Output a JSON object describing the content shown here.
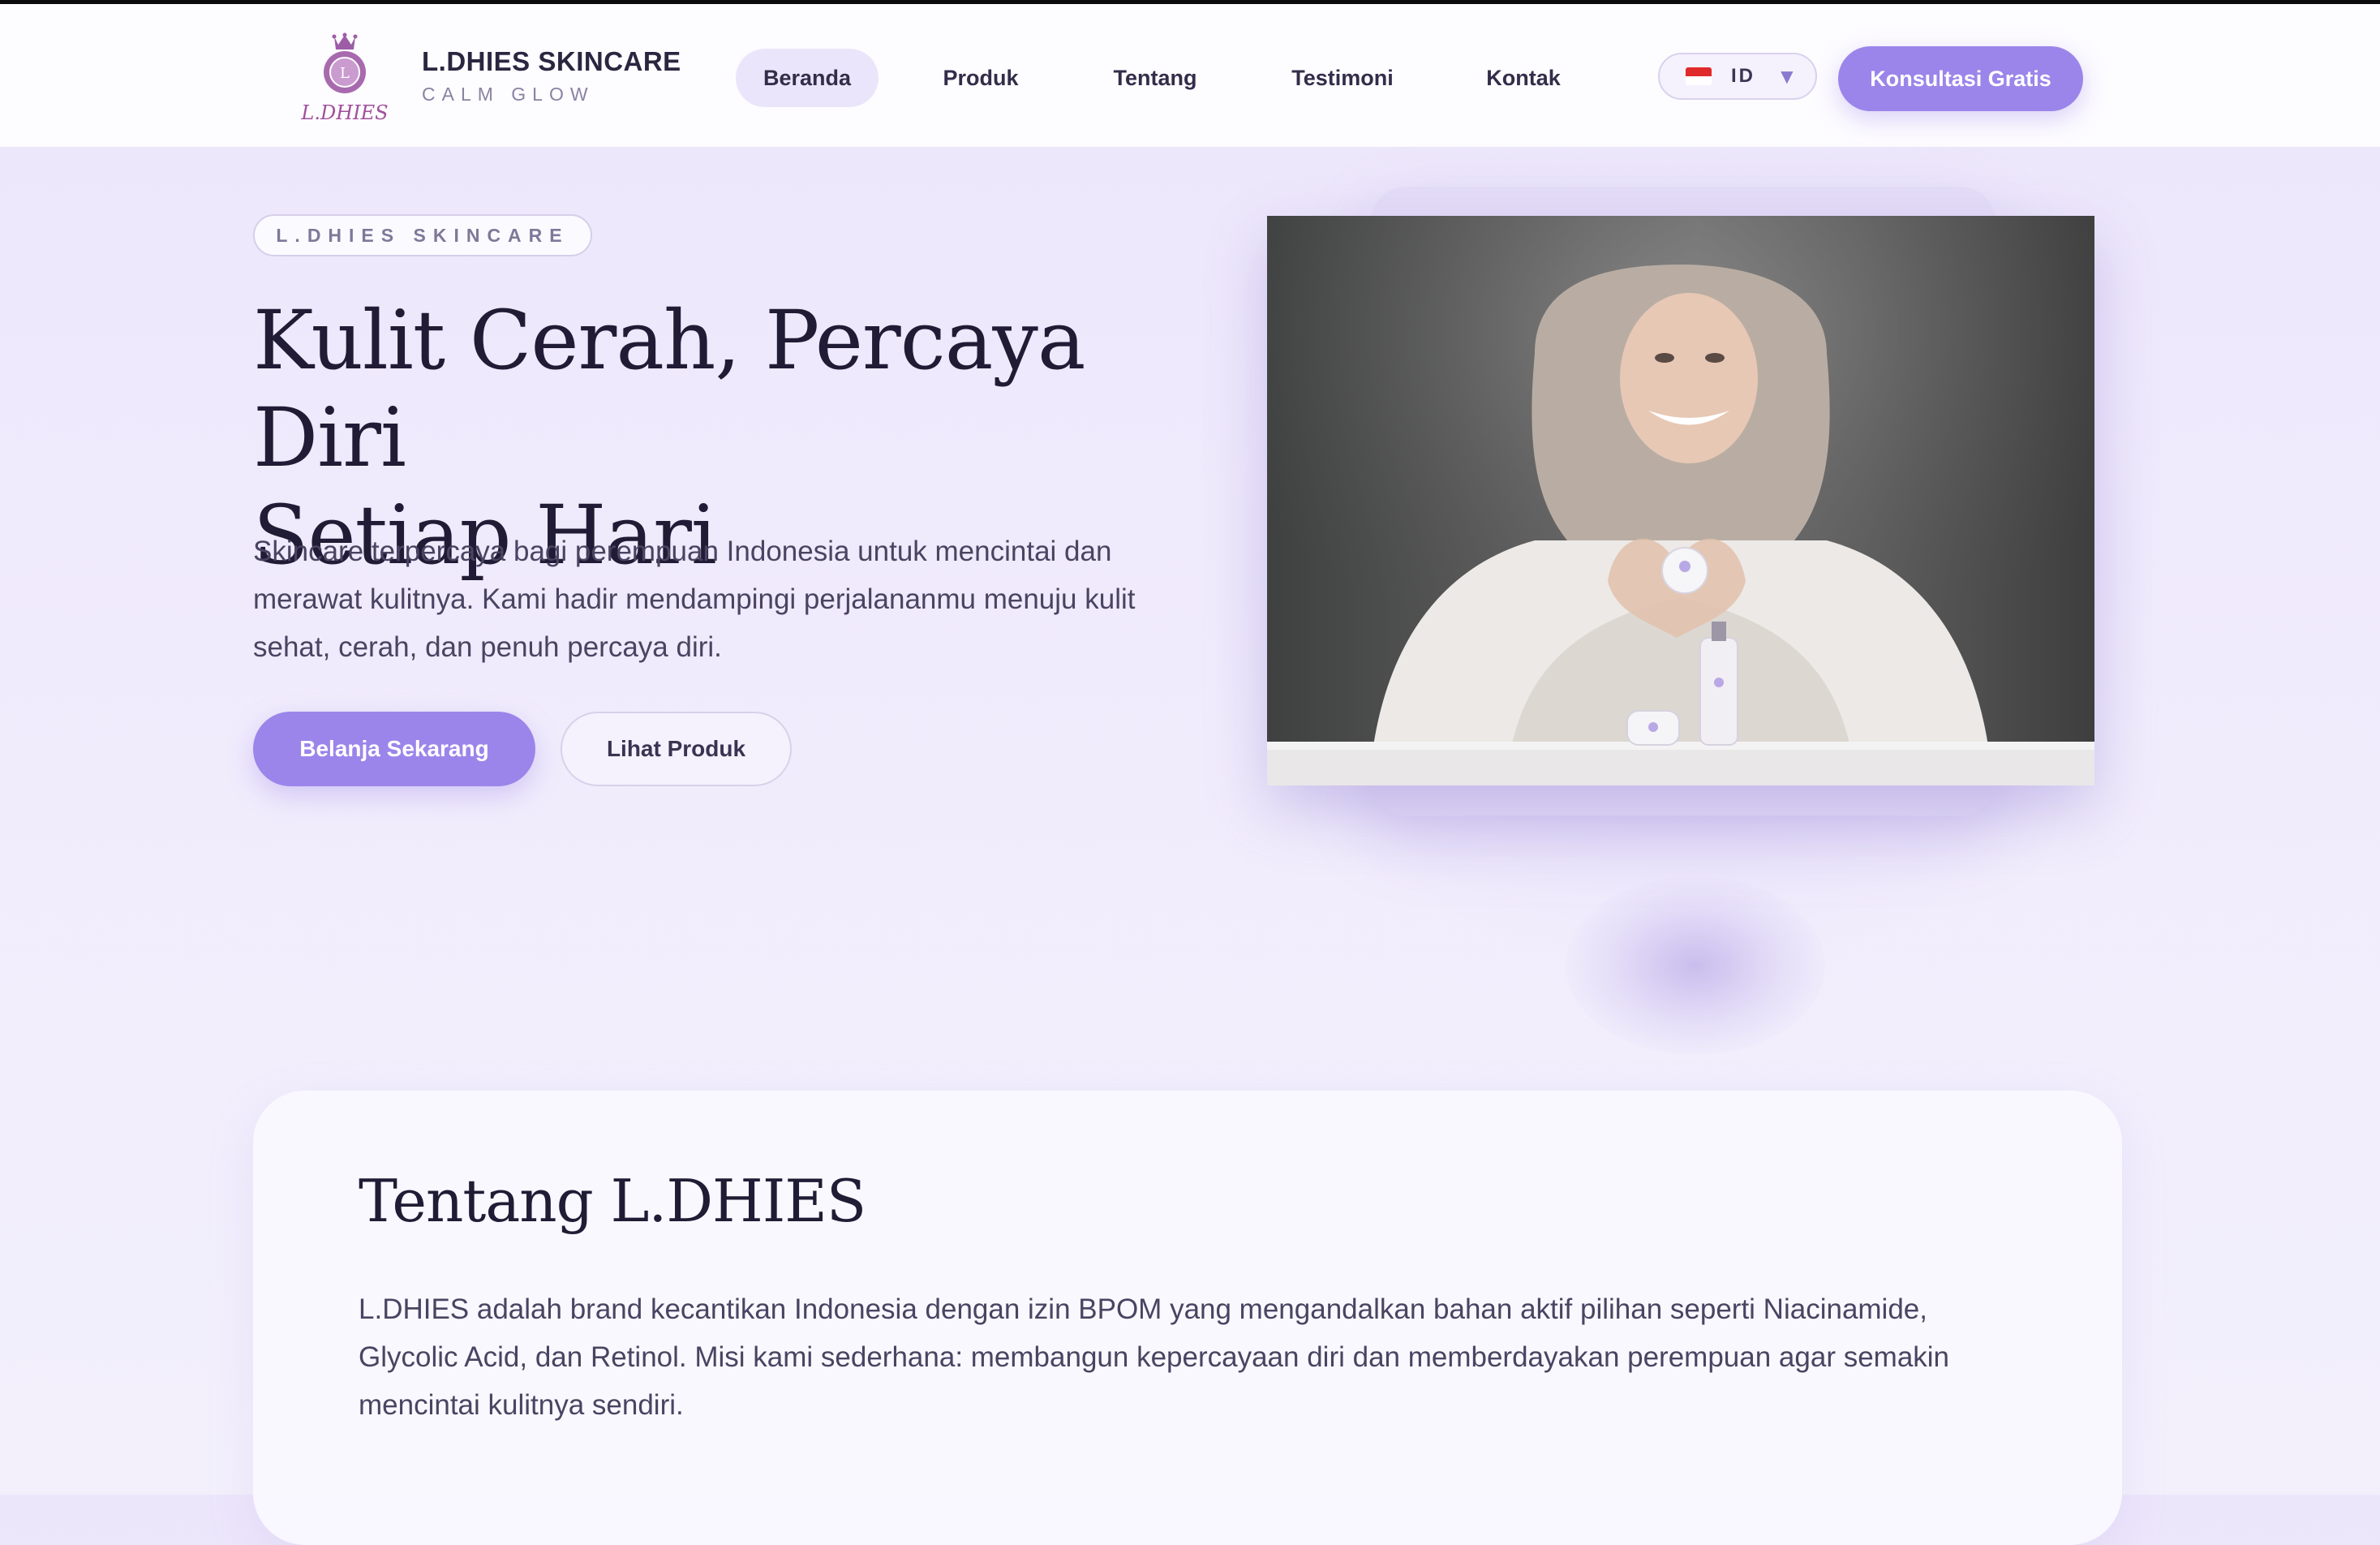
{
  "header": {
    "logo_text": "L.DHIES",
    "brand_name": "L.DHIES SKINCARE",
    "brand_tagline": "CALM GLOW",
    "nav": [
      {
        "label": "Beranda",
        "active": true
      },
      {
        "label": "Produk",
        "active": false
      },
      {
        "label": "Tentang",
        "active": false
      },
      {
        "label": "Testimoni",
        "active": false
      },
      {
        "label": "Kontak",
        "active": false
      }
    ],
    "language": {
      "code": "ID",
      "flag": "indonesia-flag-icon"
    },
    "cta_label": "Konsultasi Gratis"
  },
  "hero": {
    "badge": "L.DHIES SKINCARE",
    "title_line1": "Kulit Cerah, Percaya Diri",
    "title_line2": "Setiap Hari",
    "description": "Skincare terpercaya bagi perempuan Indonesia untuk mencintai dan merawat kulitnya. Kami hadir mendampingi perjalananmu menuju kulit sehat, cerah, dan penuh percaya diri.",
    "primary_button": "Belanja Sekarang",
    "secondary_button": "Lihat Produk"
  },
  "about": {
    "title": "Tentang L.DHIES",
    "text": "L.DHIES adalah brand kecantikan Indonesia dengan izin BPOM yang mengandalkan bahan aktif pilihan seperti Niacinamide, Glycolic Acid, dan Retinol. Misi kami sederhana: membangun kepercayaan diri dan memberdayakan perempuan agar semakin mencintai kulitnya sendiri."
  },
  "colors": {
    "accent": "#9b85ea",
    "nav_active_bg": "#ebe5fb",
    "heading": "#211c35",
    "body_text": "#4a4462",
    "page_bg": "#ece6fb"
  }
}
